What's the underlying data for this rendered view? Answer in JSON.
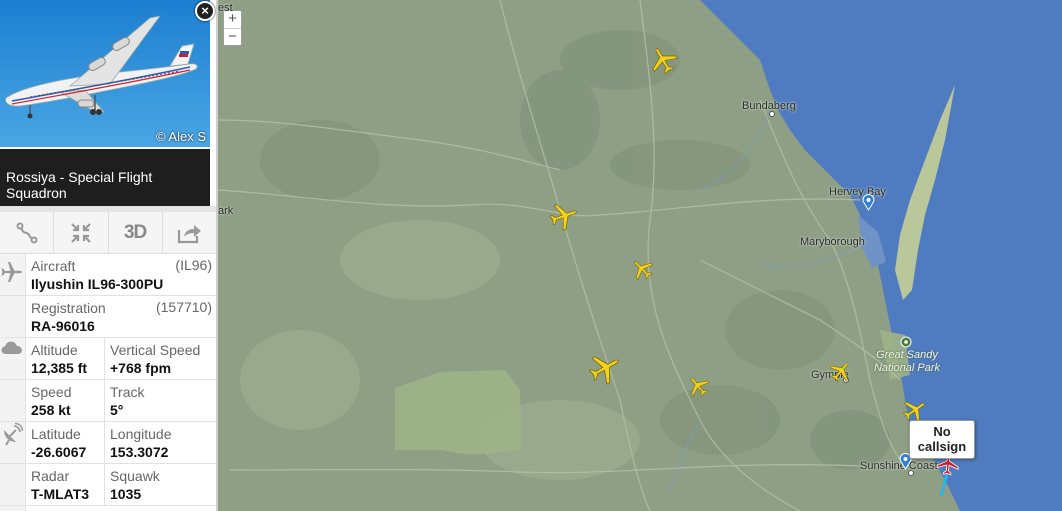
{
  "aircraft_photo": {
    "credit": "© Alex S"
  },
  "close_label": "×",
  "airline": {
    "name": "Rossiya - Special Flight Squadron"
  },
  "actions": {
    "route_icon": "route-icon",
    "collapse_icon": "collapse-icon",
    "three_d_label": "3D",
    "share_icon": "share-icon"
  },
  "details": {
    "aircraft": {
      "label": "Aircraft",
      "code": "(IL96)",
      "value": "Ilyushin IL96-300PU"
    },
    "registration": {
      "label": "Registration",
      "code": "(157710)",
      "value": "RA-96016"
    },
    "altitude": {
      "label": "Altitude",
      "value": "12,385 ft"
    },
    "vertical_speed": {
      "label": "Vertical Speed",
      "value": "+768 fpm"
    },
    "speed": {
      "label": "Speed",
      "value": "258 kt"
    },
    "track": {
      "label": "Track",
      "value": "5°"
    },
    "latitude": {
      "label": "Latitude",
      "value": "-26.6067"
    },
    "longitude": {
      "label": "Longitude",
      "value": "153.3072"
    },
    "radar": {
      "label": "Radar",
      "value": "T-MLAT3"
    },
    "squawk": {
      "label": "Squawk",
      "value": "1035"
    }
  },
  "map": {
    "zoom_in": "+",
    "zoom_out": "−",
    "places": {
      "bundaberg": "Bundaberg",
      "hervey_bay": "Hervey Bay",
      "maryborough": "Maryborough",
      "gympie": "Gympie",
      "sunshine_coast": "Sunshine Coast",
      "great_sandy": "Great Sandy National Park",
      "partial_west": "est",
      "partial_park": "ark"
    },
    "callout": "No callsign",
    "colors": {
      "land": "#8e9f86",
      "sea": "#4f7cc0",
      "plane": "#f2d21b",
      "selected_plane": "#d2202a",
      "trail": "#29b6e6"
    }
  }
}
